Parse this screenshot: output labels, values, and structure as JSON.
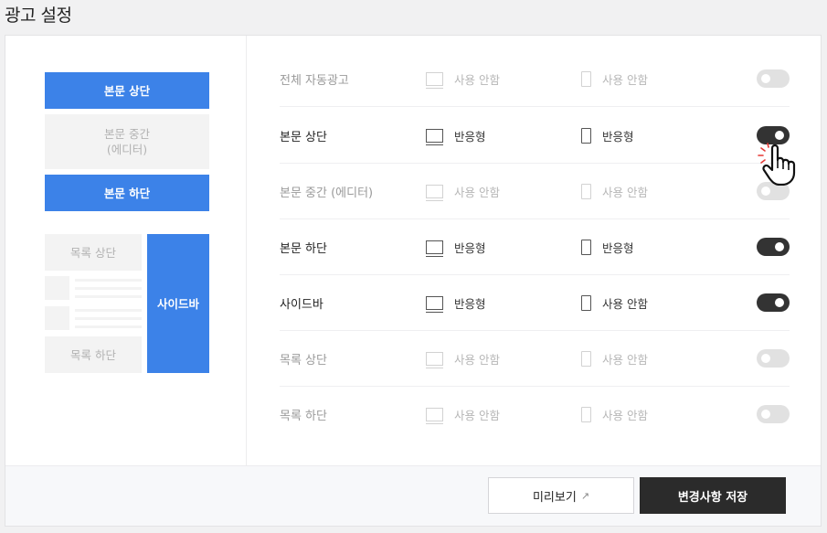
{
  "page": {
    "title": "광고 설정"
  },
  "preview": {
    "body_top": "본문 상단",
    "body_middle_line1": "본문 중간",
    "body_middle_line2": "(에디터)",
    "body_bottom": "본문 하단",
    "list_top": "목록 상단",
    "list_bottom": "목록 하단",
    "sidebar": "사이드바"
  },
  "rows": [
    {
      "name": "전체 자동광고",
      "pc": "사용 안함",
      "mobile": "사용 안함",
      "enabled": false
    },
    {
      "name": "본문 상단",
      "pc": "반응형",
      "mobile": "반응형",
      "enabled": true
    },
    {
      "name": "본문 중간 (에디터)",
      "pc": "사용 안함",
      "mobile": "사용 안함",
      "enabled": false
    },
    {
      "name": "본문 하단",
      "pc": "반응형",
      "mobile": "반응형",
      "enabled": true
    },
    {
      "name": "사이드바",
      "pc": "반응형",
      "mobile": "사용 안함",
      "enabled": true
    },
    {
      "name": "목록 상단",
      "pc": "사용 안함",
      "mobile": "사용 안함",
      "enabled": false
    },
    {
      "name": "목록 하단",
      "pc": "사용 안함",
      "mobile": "사용 안함",
      "enabled": false
    }
  ],
  "footer": {
    "preview_label": "미리보기",
    "save_label": "변경사항 저장"
  },
  "colors": {
    "accent": "#3c82e8",
    "toggle_on": "#333333",
    "toggle_off": "#e1e1e1",
    "save_button": "#2b2b2b"
  },
  "icons": {
    "pc": "monitor-icon",
    "mobile": "phone-icon",
    "external": "external-link-icon",
    "cursor": "hand-pointer-icon"
  }
}
